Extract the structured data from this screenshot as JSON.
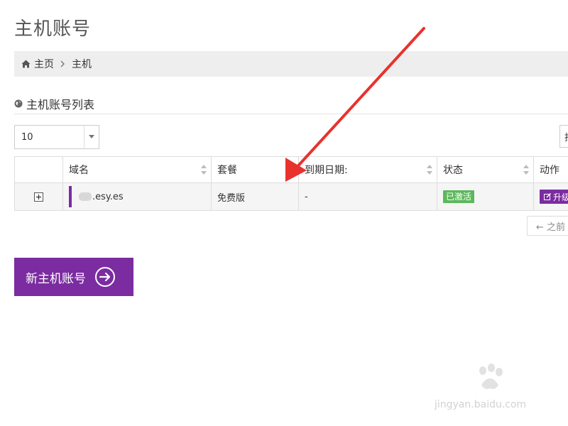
{
  "page": {
    "title": "主机账号"
  },
  "breadcrumb": {
    "home_label": "主页",
    "current_label": "主机"
  },
  "section": {
    "title": "主机账号列表"
  },
  "page_size": {
    "value": "10"
  },
  "search_stub": {
    "text": "找"
  },
  "table": {
    "columns": [
      "域名",
      "套餐",
      "到期日期:",
      "状态",
      "动作"
    ],
    "rows": [
      {
        "expand": "+",
        "domain_suffix": ".esy.es",
        "plan": "免费版",
        "expiry": "-",
        "status": "已激活",
        "action": "升级"
      }
    ]
  },
  "pager": {
    "prev_label": "← 之前"
  },
  "new_host_button": {
    "label": "新主机账号"
  },
  "watermark": {
    "url": "jingyan.baidu.com"
  },
  "colors": {
    "brand_purple": "#7b2ca0",
    "status_green": "#5cb85c",
    "annotation_red": "#e8322e",
    "breadcrumb_bg": "#eeeeee"
  },
  "icons": {
    "home": "home-icon",
    "breadcrumb_sep": "chevron-right-icon",
    "section": "globe-icon",
    "select_caret": "caret-down-icon",
    "sort": "sort-icon",
    "expand": "plus-square-icon",
    "edit": "edit-icon",
    "new_host": "arrow-circle-right-icon"
  }
}
